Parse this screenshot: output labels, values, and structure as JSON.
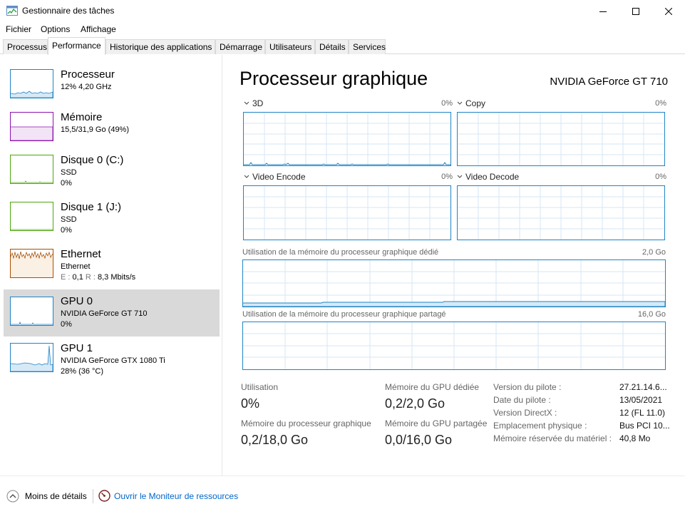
{
  "window": {
    "title": "Gestionnaire des tâches"
  },
  "menu": [
    "Fichier",
    "Options",
    "Affichage"
  ],
  "tabs": [
    {
      "label": "Processus",
      "active": false
    },
    {
      "label": "Performance",
      "active": true
    },
    {
      "label": "Historique des applications",
      "active": false
    },
    {
      "label": "Démarrage",
      "active": false
    },
    {
      "label": "Utilisateurs",
      "active": false
    },
    {
      "label": "Détails",
      "active": false
    },
    {
      "label": "Services",
      "active": false
    }
  ],
  "sidebar": {
    "items": [
      {
        "name": "Processeur",
        "line1": "12% 4,20 GHz",
        "line2": "",
        "color": "#1e84c6",
        "selected": false
      },
      {
        "name": "Mémoire",
        "line1": "15,5/31,9 Go (49%)",
        "line2": "",
        "color": "#8b12ae",
        "selected": false
      },
      {
        "name": "Disque 0 (C:)",
        "line1": "SSD",
        "line2": "0%",
        "color": "#4da60c",
        "selected": false
      },
      {
        "name": "Disque 1 (J:)",
        "line1": "SSD",
        "line2": "0%",
        "color": "#4da60c",
        "selected": false
      },
      {
        "name": "Ethernet",
        "line1": "Ethernet",
        "line2_prefix_s": "E :",
        "line2_s": "0,1",
        "line2_prefix_r": "R :",
        "line2_r": "8,3 Mbits/s",
        "color": "#a74f01",
        "selected": false
      },
      {
        "name": "GPU 0",
        "line1": "NVIDIA GeForce GT 710",
        "line2": "0%",
        "color": "#1e84c6",
        "selected": true
      },
      {
        "name": "GPU 1",
        "line1": "NVIDIA GeForce GTX 1080 Ti",
        "line2": "28% (36 °C)",
        "color": "#1e84c6",
        "selected": false
      }
    ]
  },
  "main": {
    "title": "Processeur graphique",
    "model": "NVIDIA GeForce GT 710",
    "engines": [
      {
        "label": "3D",
        "percent": "0%"
      },
      {
        "label": "Copy",
        "percent": "0%"
      },
      {
        "label": "Video Encode",
        "percent": "0%"
      },
      {
        "label": "Video Decode",
        "percent": "0%"
      }
    ],
    "dedicated_memory": {
      "label": "Utilisation de la mémoire du processeur graphique dédié",
      "max": "2,0 Go"
    },
    "shared_memory": {
      "label": "Utilisation de la mémoire du processeur graphique partagé",
      "max": "16,0 Go"
    },
    "stats": {
      "utilisation_label": "Utilisation",
      "utilisation_value": "0%",
      "gpu_mem_label": "Mémoire du processeur graphique",
      "gpu_mem_value": "0,2/18,0 Go",
      "dedicated_label": "Mémoire du GPU dédiée",
      "dedicated_value": "0,2/2,0 Go",
      "shared_label": "Mémoire du GPU partagée",
      "shared_value": "0,0/16,0 Go"
    },
    "properties": [
      {
        "key": "Version du pilote :",
        "value": "27.21.14.6..."
      },
      {
        "key": "Date du pilote :",
        "value": "13/05/2021"
      },
      {
        "key": "Version DirectX :",
        "value": "12 (FL 11.0)"
      },
      {
        "key": "Emplacement physique :",
        "value": "Bus PCI 10..."
      },
      {
        "key": "Mémoire réservée du matériel :",
        "value": "40,8 Mo"
      }
    ]
  },
  "footer": {
    "less_details": "Moins de détails",
    "resource_monitor": "Ouvrir le Moniteur de ressources"
  }
}
